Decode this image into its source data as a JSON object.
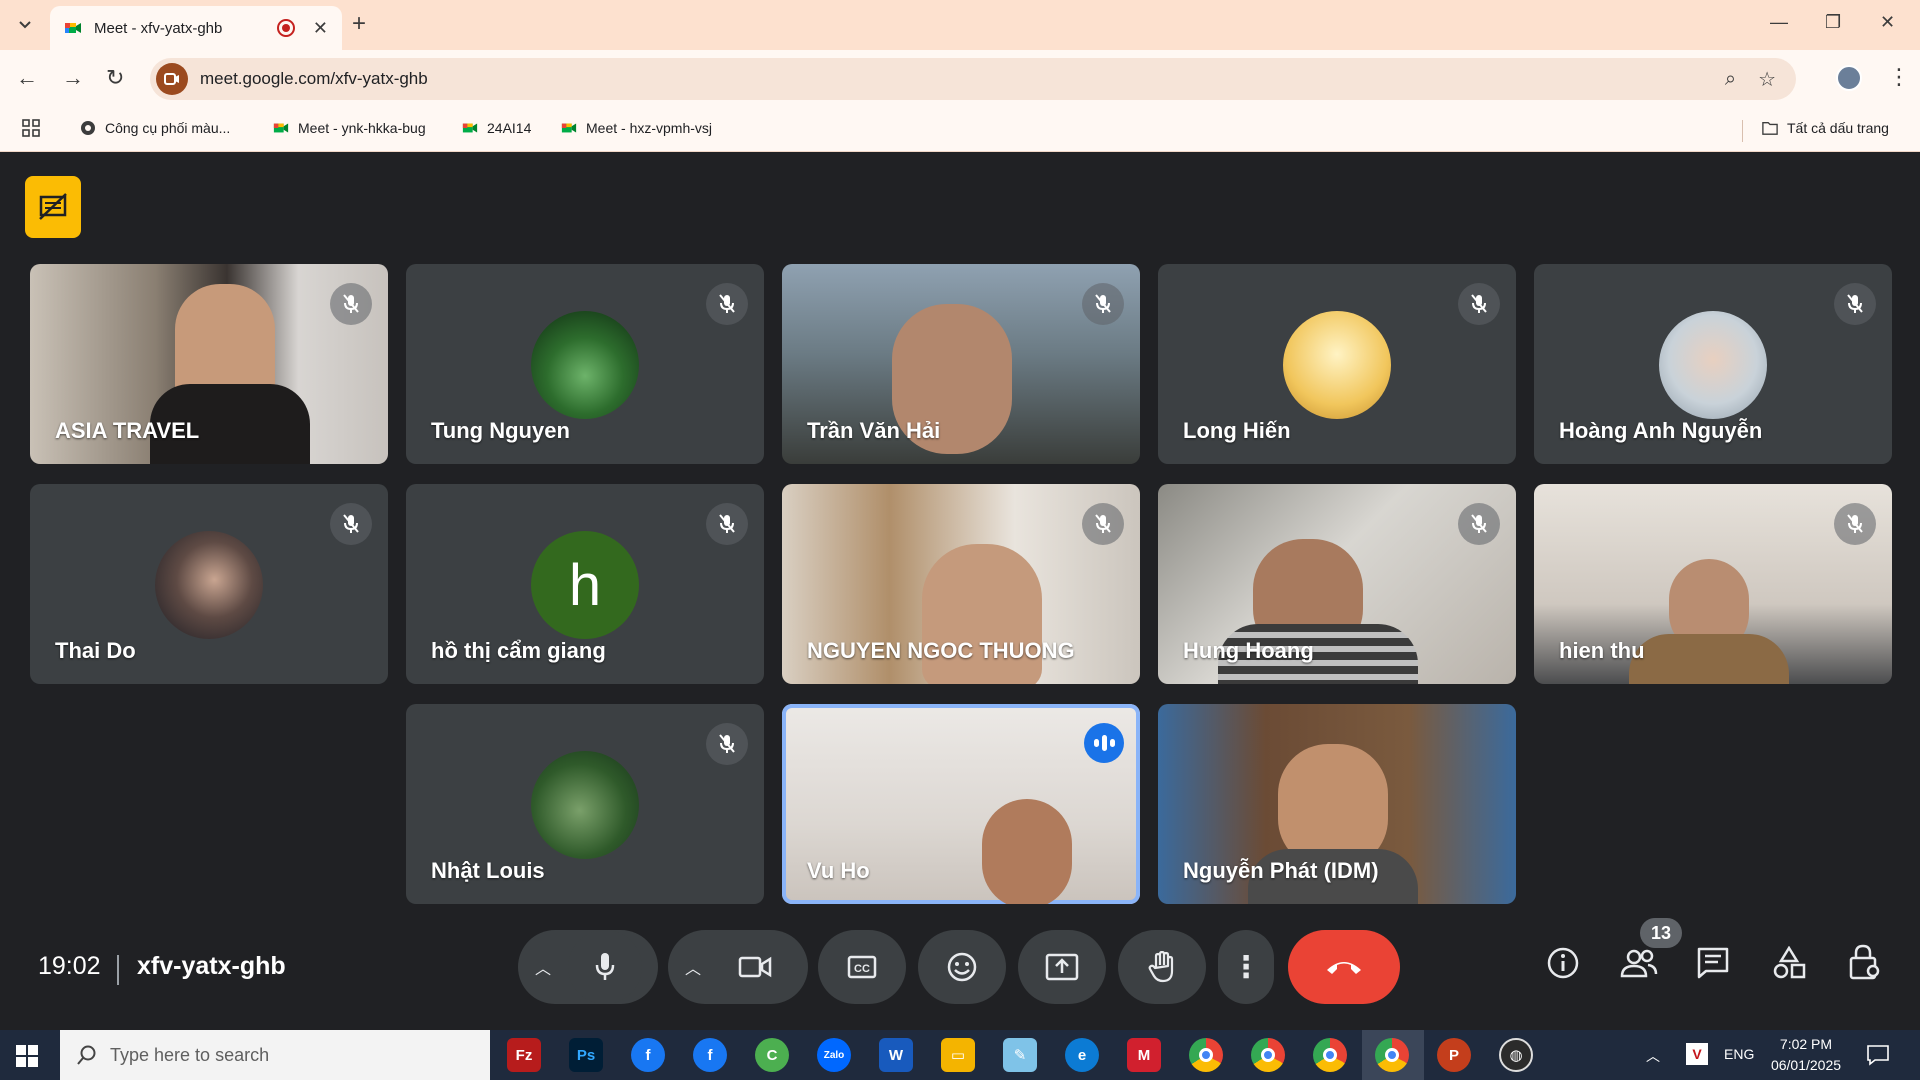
{
  "browser": {
    "tab_title": "Meet - xfv-yatx-ghb",
    "url": "meet.google.com/xfv-yatx-ghb",
    "bookmarks": [
      {
        "label": "Công cụ phối màu..."
      },
      {
        "label": "Meet - ynk-hkka-bug"
      },
      {
        "label": "24AI14"
      },
      {
        "label": "Meet - hxz-vpmh-vsj"
      }
    ],
    "all_bookmarks": "Tất cả dấu trang"
  },
  "meeting": {
    "time": "19:02",
    "code": "xfv-yatx-ghb",
    "participant_count": "13",
    "participants": [
      {
        "name": "ASIA TRAVEL",
        "muted": true,
        "video": true
      },
      {
        "name": "Tung Nguyen",
        "muted": true,
        "video": false
      },
      {
        "name": "Trần Văn Hải",
        "muted": true,
        "video": true
      },
      {
        "name": "Long Hiến",
        "muted": true,
        "video": false
      },
      {
        "name": "Hoàng Anh Nguyễn",
        "muted": true,
        "video": false
      },
      {
        "name": "Thai Do",
        "muted": true,
        "video": false
      },
      {
        "name": "hồ thị cẩm giang",
        "muted": true,
        "video": false,
        "initial": "h"
      },
      {
        "name": "NGUYEN NGOC THUONG",
        "muted": true,
        "video": true
      },
      {
        "name": "Hung Hoang",
        "muted": true,
        "video": true
      },
      {
        "name": "hien thu",
        "muted": true,
        "video": true
      },
      {
        "name": "Nhật Louis",
        "muted": true,
        "video": false
      },
      {
        "name": "Vu Ho",
        "muted": false,
        "video": true,
        "speaking": true
      },
      {
        "name": "Nguyễn Phát (IDM)",
        "muted": false,
        "video": true
      }
    ],
    "colors": {
      "end_call": "#ea4335",
      "speaking": "#8ab4f8",
      "host_badge": "#fbbc04"
    }
  },
  "taskbar": {
    "search_placeholder": "Type here to search",
    "language": "ENG",
    "clock_time": "7:02 PM",
    "clock_date": "06/01/2025",
    "apps": [
      "FileZilla",
      "Photoshop",
      "Facebook",
      "Facebook",
      "CCleaner",
      "Zalo",
      "Word",
      "File Explorer",
      "Notepad",
      "Edge",
      "Mendeley",
      "Chrome",
      "Chrome",
      "Chrome",
      "Chrome",
      "PowerPoint",
      "OBS"
    ]
  }
}
